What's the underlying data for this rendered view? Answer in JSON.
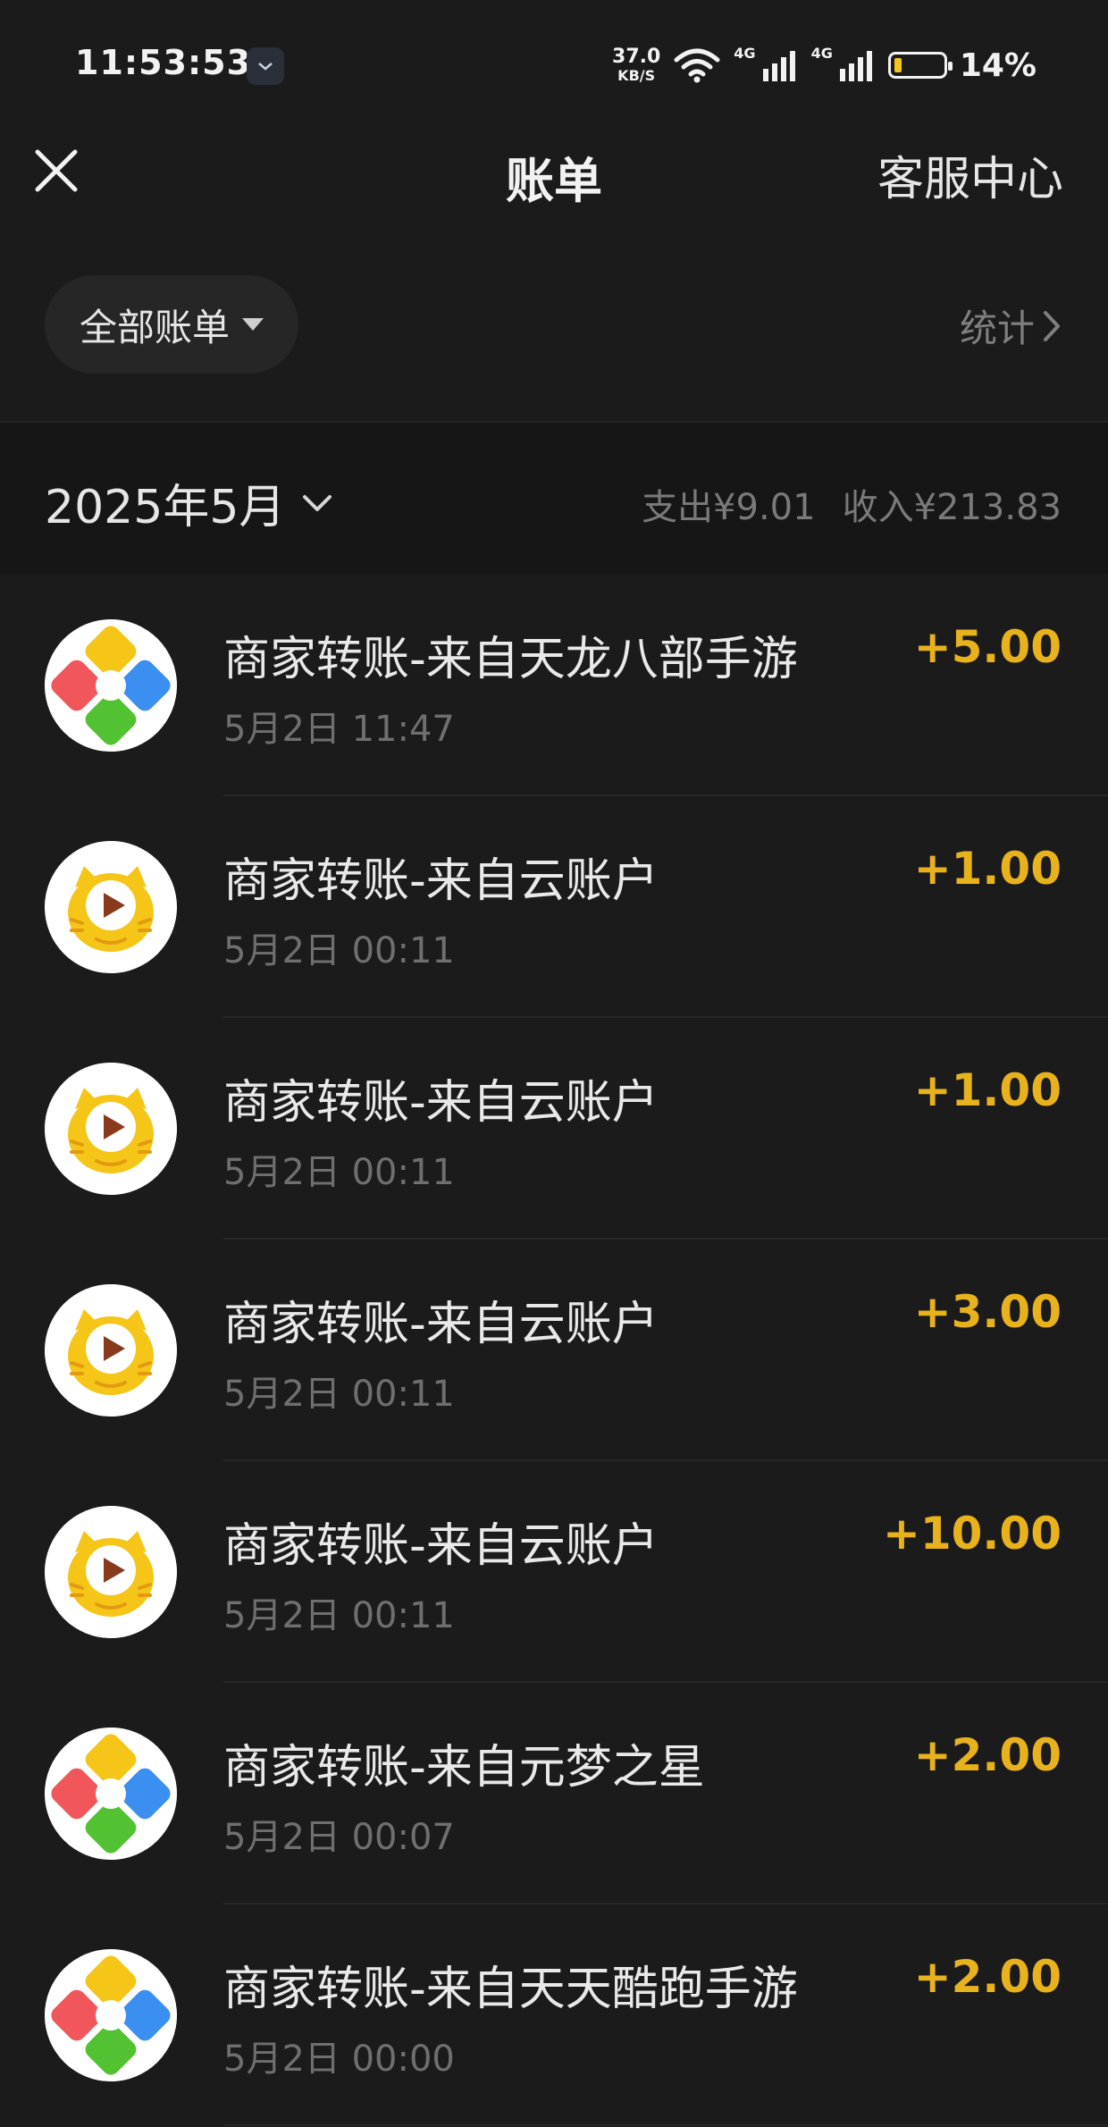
{
  "status_bar": {
    "time": "11:53:53",
    "net_speed_value": "37.0",
    "net_speed_unit": "KB/S",
    "signal1_label": "4G",
    "signal2_label": "4G",
    "battery_percent": "14%",
    "battery_level": 0.14
  },
  "nav": {
    "title": "账单",
    "service": "客服中心",
    "close_icon": "close-icon"
  },
  "filter": {
    "label": "全部账单",
    "stats": "统计"
  },
  "month": {
    "label": "2025年5月",
    "expense": "支出¥9.01",
    "income": "收入¥213.83"
  },
  "colors": {
    "background": "#1b1b1b",
    "amount": "#e8b21c",
    "battery_fill": "#f5c518"
  },
  "transactions": [
    {
      "title": "商家转账-来自天龙八部手游",
      "time": "5月2日 11:47",
      "amount": "+5.00",
      "icon": "pinwheel-icon"
    },
    {
      "title": "商家转账-来自云账户",
      "time": "5月2日 00:11",
      "amount": "+1.00",
      "icon": "tiger-icon"
    },
    {
      "title": "商家转账-来自云账户",
      "time": "5月2日 00:11",
      "amount": "+1.00",
      "icon": "tiger-icon"
    },
    {
      "title": "商家转账-来自云账户",
      "time": "5月2日 00:11",
      "amount": "+3.00",
      "icon": "tiger-icon"
    },
    {
      "title": "商家转账-来自云账户",
      "time": "5月2日 00:11",
      "amount": "+10.00",
      "icon": "tiger-icon"
    },
    {
      "title": "商家转账-来自元梦之星",
      "time": "5月2日 00:07",
      "amount": "+2.00",
      "icon": "pinwheel-icon"
    },
    {
      "title": "商家转账-来自天天酷跑手游",
      "time": "5月2日 00:00",
      "amount": "+2.00",
      "icon": "pinwheel-icon"
    }
  ]
}
